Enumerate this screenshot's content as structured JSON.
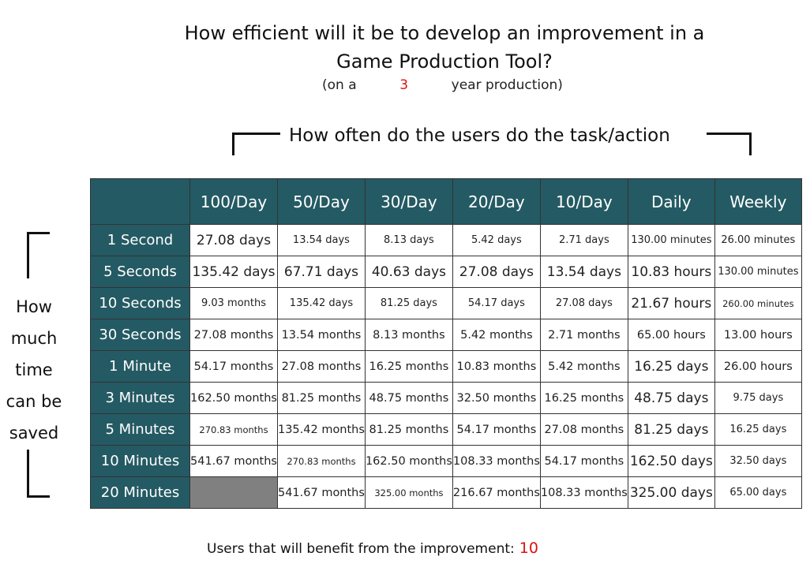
{
  "title_line1": "How efficient will it be to develop an improvement in a",
  "title_line2": "Game Production Tool?",
  "subtitle_prefix": "(on a",
  "years": "3",
  "subtitle_suffix": "year production)",
  "column_axis_label": "How often do the users do the task/action",
  "row_axis_label": [
    "How",
    "much",
    "time",
    "can be",
    "saved"
  ],
  "table": {
    "corner": "",
    "columns": [
      "100/Day",
      "50/Day",
      "30/Day",
      "20/Day",
      "10/Day",
      "Daily",
      "Weekly"
    ],
    "rows": [
      {
        "label": "1  Second",
        "cells": [
          "27.08 days",
          "13.54 days",
          "8.13 days",
          "5.42 days",
          "2.71 days",
          "130.00 minutes",
          "26.00 minutes"
        ]
      },
      {
        "label": "5  Seconds",
        "cells": [
          "135.42 days",
          "67.71 days",
          "40.63 days",
          "27.08 days",
          "13.54 days",
          "10.83 hours",
          "130.00 minutes"
        ]
      },
      {
        "label": "10  Seconds",
        "cells": [
          "9.03 months",
          "135.42 days",
          "81.25 days",
          "54.17 days",
          "27.08 days",
          "21.67 hours",
          "260.00 minutes"
        ]
      },
      {
        "label": "30  Seconds",
        "cells": [
          "27.08 months",
          "13.54 months",
          "8.13 months",
          "5.42 months",
          "2.71 months",
          "65.00 hours",
          "13.00 hours"
        ]
      },
      {
        "label": "1 Minute",
        "cells": [
          "54.17 months",
          "27.08 months",
          "16.25 months",
          "10.83 months",
          "5.42 months",
          "16.25 days",
          "26.00 hours"
        ]
      },
      {
        "label": "3 Minutes",
        "cells": [
          "162.50 months",
          "81.25 months",
          "48.75 months",
          "32.50 months",
          "16.25 months",
          "48.75 days",
          "9.75 days"
        ]
      },
      {
        "label": "5 Minutes",
        "cells": [
          "270.83 months",
          "135.42 months",
          "81.25 months",
          "54.17 months",
          "27.08 months",
          "81.25 days",
          "16.25 days"
        ]
      },
      {
        "label": "10 Minutes",
        "cells": [
          "541.67 months",
          "270.83 months",
          "162.50 months",
          "108.33 months",
          "54.17 months",
          "162.50 days",
          "32.50 days"
        ]
      },
      {
        "label": "20 Minutes",
        "cells": [
          "",
          "541.67 months",
          "325.00 months",
          "216.67 months",
          "108.33 months",
          "325.00 days",
          "65.00 days"
        ]
      }
    ],
    "font_classes": [
      [
        "fs-big",
        "fs-sm",
        "fs-sm",
        "fs-sm",
        "fs-sm",
        "fs-sm",
        "fs-sm"
      ],
      [
        "fs-big",
        "fs-big",
        "fs-big",
        "fs-big",
        "fs-big",
        "fs-big",
        "fs-sm"
      ],
      [
        "fs-sm",
        "fs-sm",
        "fs-sm",
        "fs-sm",
        "fs-sm",
        "fs-big",
        "fs-xs"
      ],
      [
        "fs-med",
        "fs-med",
        "fs-med",
        "fs-med",
        "fs-med",
        "fs-med",
        "fs-med"
      ],
      [
        "fs-med",
        "fs-med",
        "fs-med",
        "fs-med",
        "fs-med",
        "fs-big",
        "fs-med"
      ],
      [
        "fs-med",
        "fs-med",
        "fs-med",
        "fs-med",
        "fs-med",
        "fs-big",
        "fs-sm"
      ],
      [
        "fs-xs",
        "fs-med",
        "fs-med",
        "fs-med",
        "fs-med",
        "fs-big",
        "fs-sm"
      ],
      [
        "fs-med",
        "fs-xs",
        "fs-med",
        "fs-med",
        "fs-med",
        "fs-big",
        "fs-sm"
      ],
      [
        "fs-med",
        "fs-med",
        "fs-xs",
        "fs-med",
        "fs-med",
        "fs-big",
        "fs-sm"
      ]
    ],
    "empty_cell_color": "#808080",
    "header_color": "#245a63"
  },
  "footer_label": "Users that will benefit from the improvement:",
  "users": "10",
  "accent_color": "#dd1111"
}
